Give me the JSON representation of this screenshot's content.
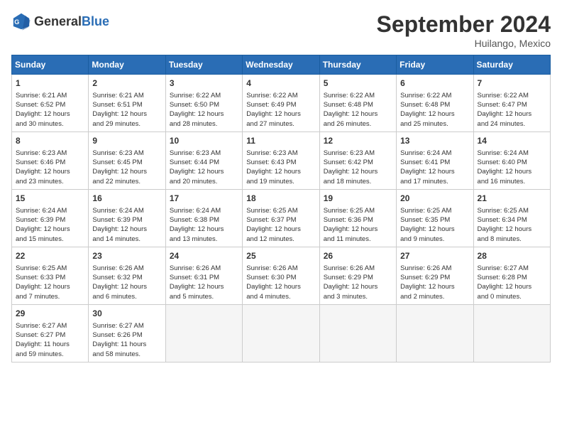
{
  "logo": {
    "text1": "General",
    "text2": "Blue"
  },
  "title": "September 2024",
  "location": "Huilango, Mexico",
  "headers": [
    "Sunday",
    "Monday",
    "Tuesday",
    "Wednesday",
    "Thursday",
    "Friday",
    "Saturday"
  ],
  "weeks": [
    [
      {
        "day": "1",
        "info": "Sunrise: 6:21 AM\nSunset: 6:52 PM\nDaylight: 12 hours\nand 30 minutes."
      },
      {
        "day": "2",
        "info": "Sunrise: 6:21 AM\nSunset: 6:51 PM\nDaylight: 12 hours\nand 29 minutes."
      },
      {
        "day": "3",
        "info": "Sunrise: 6:22 AM\nSunset: 6:50 PM\nDaylight: 12 hours\nand 28 minutes."
      },
      {
        "day": "4",
        "info": "Sunrise: 6:22 AM\nSunset: 6:49 PM\nDaylight: 12 hours\nand 27 minutes."
      },
      {
        "day": "5",
        "info": "Sunrise: 6:22 AM\nSunset: 6:48 PM\nDaylight: 12 hours\nand 26 minutes."
      },
      {
        "day": "6",
        "info": "Sunrise: 6:22 AM\nSunset: 6:48 PM\nDaylight: 12 hours\nand 25 minutes."
      },
      {
        "day": "7",
        "info": "Sunrise: 6:22 AM\nSunset: 6:47 PM\nDaylight: 12 hours\nand 24 minutes."
      }
    ],
    [
      {
        "day": "8",
        "info": "Sunrise: 6:23 AM\nSunset: 6:46 PM\nDaylight: 12 hours\nand 23 minutes."
      },
      {
        "day": "9",
        "info": "Sunrise: 6:23 AM\nSunset: 6:45 PM\nDaylight: 12 hours\nand 22 minutes."
      },
      {
        "day": "10",
        "info": "Sunrise: 6:23 AM\nSunset: 6:44 PM\nDaylight: 12 hours\nand 20 minutes."
      },
      {
        "day": "11",
        "info": "Sunrise: 6:23 AM\nSunset: 6:43 PM\nDaylight: 12 hours\nand 19 minutes."
      },
      {
        "day": "12",
        "info": "Sunrise: 6:23 AM\nSunset: 6:42 PM\nDaylight: 12 hours\nand 18 minutes."
      },
      {
        "day": "13",
        "info": "Sunrise: 6:24 AM\nSunset: 6:41 PM\nDaylight: 12 hours\nand 17 minutes."
      },
      {
        "day": "14",
        "info": "Sunrise: 6:24 AM\nSunset: 6:40 PM\nDaylight: 12 hours\nand 16 minutes."
      }
    ],
    [
      {
        "day": "15",
        "info": "Sunrise: 6:24 AM\nSunset: 6:39 PM\nDaylight: 12 hours\nand 15 minutes."
      },
      {
        "day": "16",
        "info": "Sunrise: 6:24 AM\nSunset: 6:39 PM\nDaylight: 12 hours\nand 14 minutes."
      },
      {
        "day": "17",
        "info": "Sunrise: 6:24 AM\nSunset: 6:38 PM\nDaylight: 12 hours\nand 13 minutes."
      },
      {
        "day": "18",
        "info": "Sunrise: 6:25 AM\nSunset: 6:37 PM\nDaylight: 12 hours\nand 12 minutes."
      },
      {
        "day": "19",
        "info": "Sunrise: 6:25 AM\nSunset: 6:36 PM\nDaylight: 12 hours\nand 11 minutes."
      },
      {
        "day": "20",
        "info": "Sunrise: 6:25 AM\nSunset: 6:35 PM\nDaylight: 12 hours\nand 9 minutes."
      },
      {
        "day": "21",
        "info": "Sunrise: 6:25 AM\nSunset: 6:34 PM\nDaylight: 12 hours\nand 8 minutes."
      }
    ],
    [
      {
        "day": "22",
        "info": "Sunrise: 6:25 AM\nSunset: 6:33 PM\nDaylight: 12 hours\nand 7 minutes."
      },
      {
        "day": "23",
        "info": "Sunrise: 6:26 AM\nSunset: 6:32 PM\nDaylight: 12 hours\nand 6 minutes."
      },
      {
        "day": "24",
        "info": "Sunrise: 6:26 AM\nSunset: 6:31 PM\nDaylight: 12 hours\nand 5 minutes."
      },
      {
        "day": "25",
        "info": "Sunrise: 6:26 AM\nSunset: 6:30 PM\nDaylight: 12 hours\nand 4 minutes."
      },
      {
        "day": "26",
        "info": "Sunrise: 6:26 AM\nSunset: 6:29 PM\nDaylight: 12 hours\nand 3 minutes."
      },
      {
        "day": "27",
        "info": "Sunrise: 6:26 AM\nSunset: 6:29 PM\nDaylight: 12 hours\nand 2 minutes."
      },
      {
        "day": "28",
        "info": "Sunrise: 6:27 AM\nSunset: 6:28 PM\nDaylight: 12 hours\nand 0 minutes."
      }
    ],
    [
      {
        "day": "29",
        "info": "Sunrise: 6:27 AM\nSunset: 6:27 PM\nDaylight: 11 hours\nand 59 minutes."
      },
      {
        "day": "30",
        "info": "Sunrise: 6:27 AM\nSunset: 6:26 PM\nDaylight: 11 hours\nand 58 minutes."
      },
      {
        "day": "",
        "info": ""
      },
      {
        "day": "",
        "info": ""
      },
      {
        "day": "",
        "info": ""
      },
      {
        "day": "",
        "info": ""
      },
      {
        "day": "",
        "info": ""
      }
    ]
  ]
}
